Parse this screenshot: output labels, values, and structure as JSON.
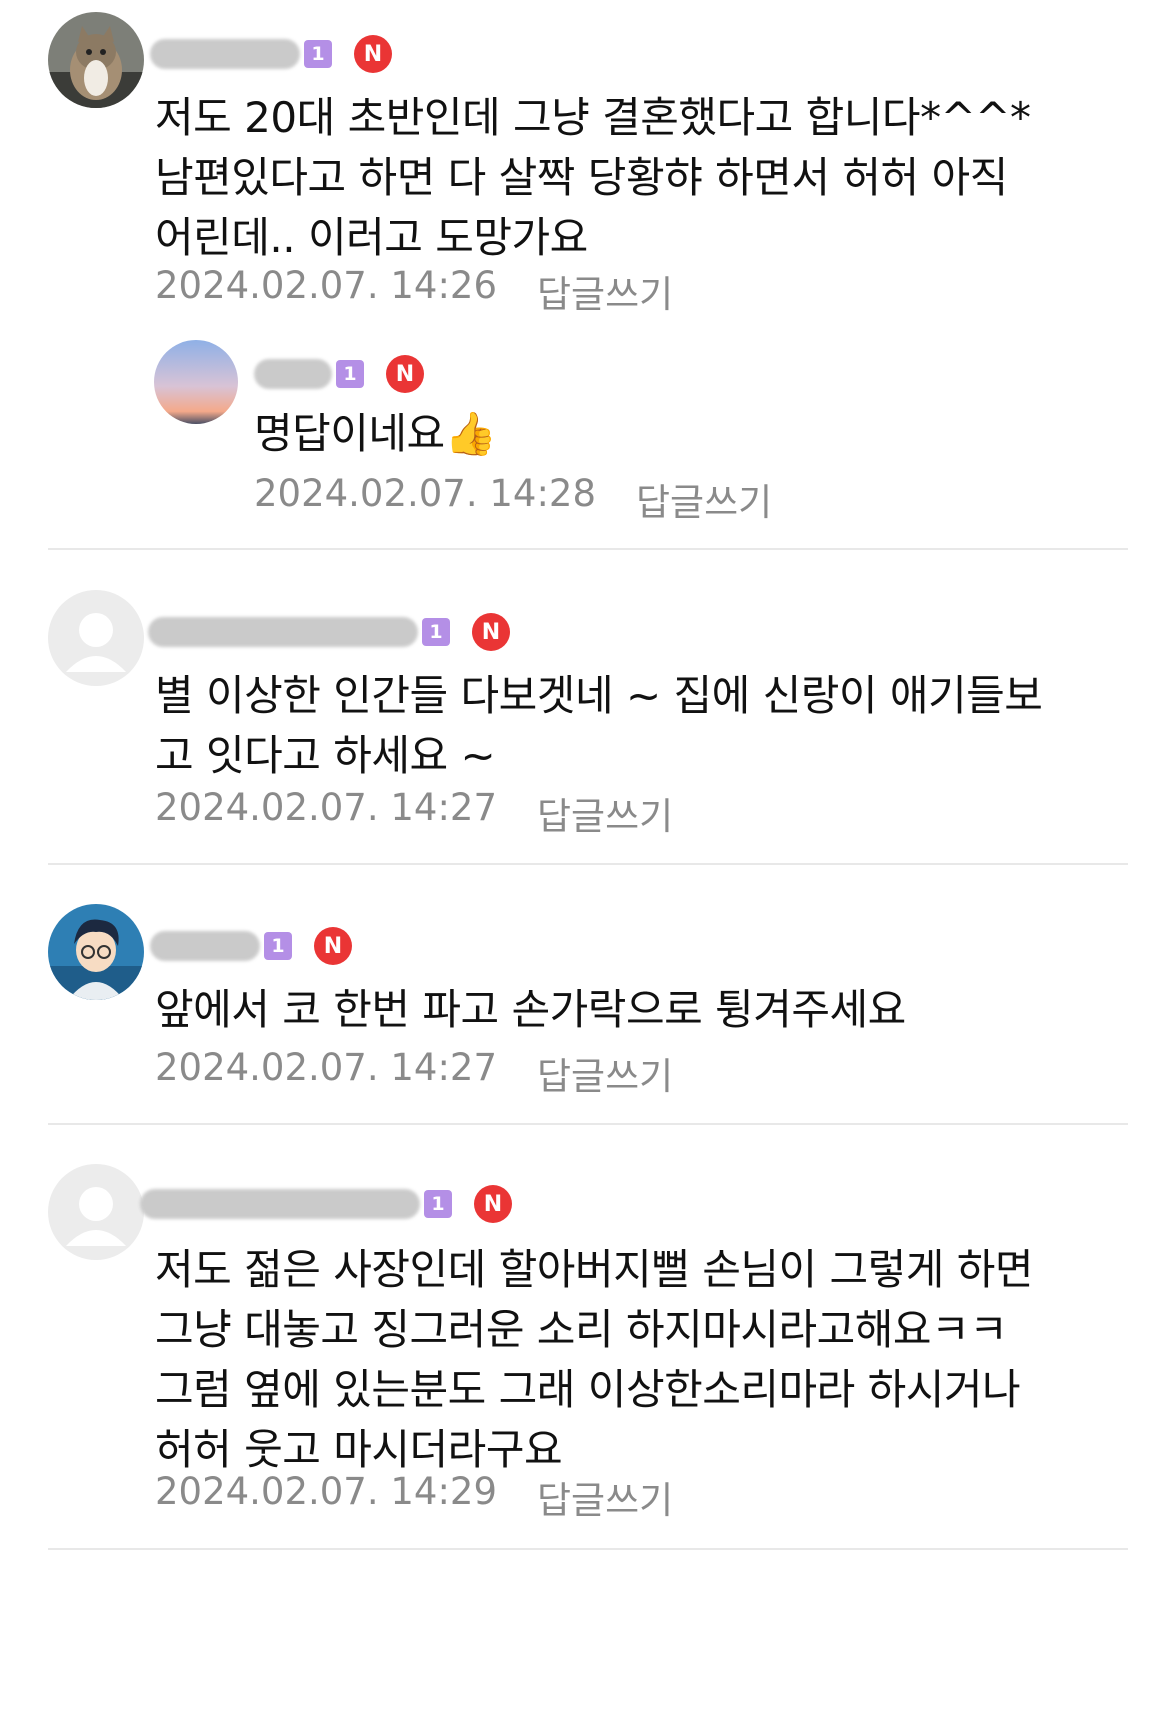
{
  "comments": [
    {
      "text": "저도 20대 초반인데 그냥 결혼했다고 합니다*^^*\n남편있다고 하면 다 살짝 당황햐 하면서 허허 아직\n어린데.. 이러고 도망가요",
      "level": "1",
      "badge": "N",
      "date": "2024.02.07. 14:26",
      "reply_label": "답글쓰기",
      "avatar": "cat-photo",
      "reply": {
        "text": "명답이네요👍",
        "level": "1",
        "badge": "N",
        "date": "2024.02.07. 14:28",
        "reply_label": "답글쓰기",
        "avatar": "sunset-photo"
      }
    },
    {
      "text": "별 이상한 인간들 다보겟네 ~ 집에 신랑이 애기들보\n고 잇다고 하세요 ~",
      "level": "1",
      "badge": "N",
      "date": "2024.02.07. 14:27",
      "reply_label": "답글쓰기",
      "avatar": "default-user"
    },
    {
      "text": "앞에서 코 한번 파고 손가락으로 튕겨주세요",
      "level": "1",
      "badge": "N",
      "date": "2024.02.07. 14:27",
      "reply_label": "답글쓰기",
      "avatar": "cartoon-character"
    },
    {
      "text": "저도 젊은 사장인데 할아버지뻘 손님이 그렇게 하면\n그냥 대놓고 징그러운 소리 하지마시라고해요ㅋㅋ\n그럼 옆에 있는분도 그래 이상한소리마라 하시거나\n허허 웃고 마시더라구요",
      "level": "1",
      "badge": "N",
      "date": "2024.02.07. 14:29",
      "reply_label": "답글쓰기",
      "avatar": "default-user"
    }
  ],
  "colors": {
    "level_badge": "#b48fe6",
    "new_badge": "#ea3535",
    "meta_text": "#8a8a8a",
    "divider": "#e8e8e8"
  }
}
